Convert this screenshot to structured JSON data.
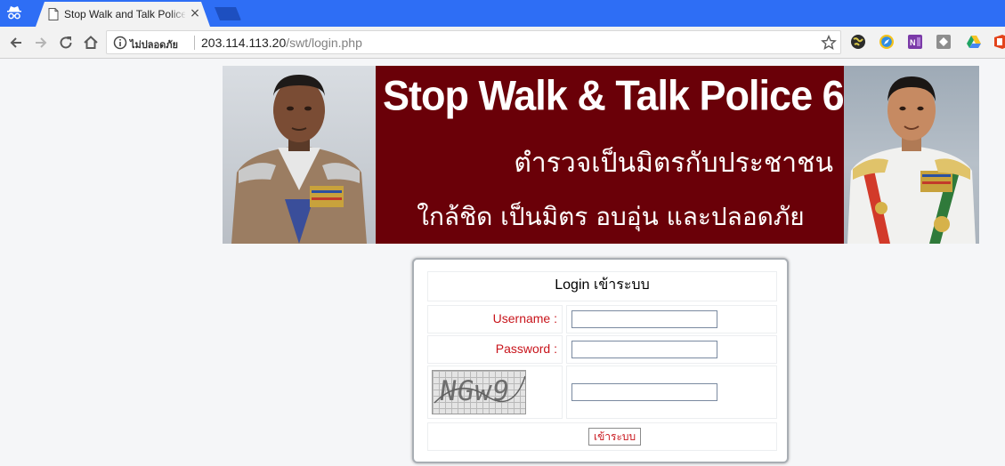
{
  "browser": {
    "tab_title": "Stop Walk and Talk Police 6",
    "tab_close": "×",
    "security_label": "ไม่ปลอดภัย",
    "url_host": "203.114.113.20",
    "url_path": "/swt/login.php"
  },
  "icons": {
    "incognito": "incognito-icon",
    "back": "back-arrow-icon",
    "forward": "forward-arrow-icon",
    "reload": "reload-icon",
    "home": "home-icon",
    "info": "info-icon",
    "bookmark": "star-icon",
    "extensions": [
      "globe-extension-icon",
      "compass-extension-icon",
      "onenote-icon",
      "extension-box-icon",
      "google-drive-icon",
      "office-icon"
    ]
  },
  "banner": {
    "title": "Stop Walk & Talk Police 6",
    "line2": "ตำรวจเป็นมิตรกับประชาชน",
    "line3": "ใกล้ชิด เป็นมิตร อบอุ่น และปลอดภัย",
    "background_color": "#6a0008"
  },
  "login": {
    "title": "Login เข้าระบบ",
    "username_label": "Username :",
    "username_value": "",
    "password_label": "Password :",
    "password_value": "",
    "captcha_text": "NGw9",
    "captcha_value": "",
    "submit_label": "เข้าระบบ",
    "label_color": "#c8141b"
  },
  "colors": {
    "tabstrip": "#2e6ef5",
    "toolbar": "#f2f2f2",
    "page_background": "#f5f6f8"
  }
}
